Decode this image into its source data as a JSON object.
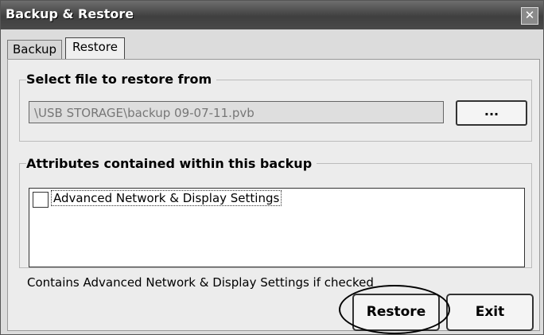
{
  "window": {
    "title": "Backup & Restore",
    "close_glyph": "✕"
  },
  "tabs": [
    {
      "label": "Backup"
    },
    {
      "label": "Restore",
      "active": true
    }
  ],
  "file_group": {
    "label": "Select file to restore from",
    "path": "\\USB STORAGE\\backup 09-07-11.pvb",
    "browse_label": "..."
  },
  "attributes_group": {
    "label": "Attributes contained within this backup",
    "items": [
      {
        "label": "Advanced Network & Display Settings",
        "checked": false
      }
    ]
  },
  "note": "Contains Advanced Network & Display Settings if checked",
  "buttons": {
    "restore": "Restore",
    "exit": "Exit"
  }
}
